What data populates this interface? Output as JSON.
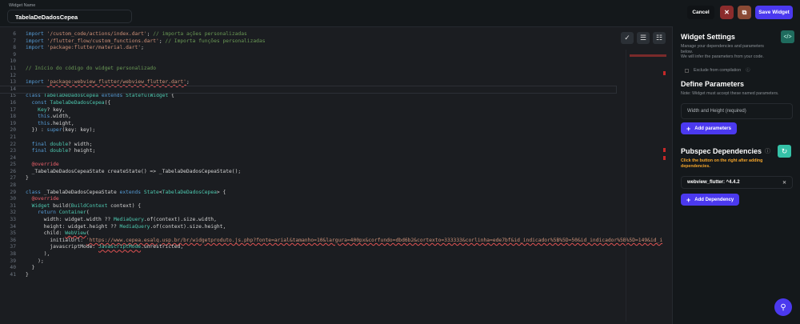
{
  "header": {
    "widget_name_label": "Widget Name",
    "widget_name": "TabelaDeDadosCepea",
    "cancel": "Cancel",
    "save": "Save Widget"
  },
  "editor": {
    "lines": [
      {
        "n": "6",
        "t": [
          [
            "import",
            "kw"
          ],
          " ",
          [
            "'/custom_code/actions/index.dart'",
            "str"
          ],
          "; ",
          [
            "// importa ações personalizadas",
            "cm"
          ]
        ]
      },
      {
        "n": "7",
        "t": [
          [
            "import",
            "kw"
          ],
          " ",
          [
            "'/flutter_flow/custom_functions.dart'",
            "str"
          ],
          "; ",
          [
            "// Importa funções personalizadas",
            "cm"
          ]
        ]
      },
      {
        "n": "8",
        "t": [
          [
            "import",
            "kw"
          ],
          " ",
          [
            "'package:flutter/material.dart'",
            "str"
          ],
          ";"
        ]
      },
      {
        "n": "9",
        "t": []
      },
      {
        "n": "10",
        "t": []
      },
      {
        "n": "11",
        "t": [
          [
            "// Início do código do widget personalizado",
            "cm"
          ]
        ]
      },
      {
        "n": "12",
        "t": []
      },
      {
        "n": "13",
        "t": [
          [
            "import",
            "kw"
          ],
          " ",
          [
            "'package:webview_flutter/webview_flutter.dart'",
            "str u"
          ],
          ";"
        ]
      },
      {
        "n": "14",
        "t": [],
        "cur": true
      },
      {
        "n": "15",
        "t": [
          [
            "class",
            "kw"
          ],
          " ",
          [
            "TabelaDeDadosCepea",
            "ty"
          ],
          " ",
          [
            "extends",
            "kw"
          ],
          " ",
          [
            "StatefulWidget",
            "ty"
          ],
          " {"
        ]
      },
      {
        "n": "16",
        "t": [
          "  ",
          [
            "const",
            "kw"
          ],
          " ",
          [
            "TabelaDeDadosCepea",
            "ty"
          ],
          "({"
        ]
      },
      {
        "n": "17",
        "t": [
          "    ",
          [
            "Key",
            "ty"
          ],
          "? key,"
        ]
      },
      {
        "n": "18",
        "t": [
          "    ",
          [
            "this",
            "kw"
          ],
          ".width,"
        ]
      },
      {
        "n": "19",
        "t": [
          "    ",
          [
            "this",
            "kw"
          ],
          ".height,"
        ]
      },
      {
        "n": "20",
        "t": [
          "  }) : ",
          [
            "super",
            "kw"
          ],
          "(key: key);"
        ]
      },
      {
        "n": "21",
        "t": []
      },
      {
        "n": "22",
        "t": [
          "  ",
          [
            "final",
            "kw"
          ],
          " ",
          [
            "double",
            "ty"
          ],
          "? width;"
        ]
      },
      {
        "n": "23",
        "t": [
          "  ",
          [
            "final",
            "kw"
          ],
          " ",
          [
            "double",
            "ty"
          ],
          "? height;"
        ]
      },
      {
        "n": "24",
        "t": []
      },
      {
        "n": "25",
        "t": [
          "  ",
          [
            "@override",
            "an"
          ]
        ]
      },
      {
        "n": "26",
        "t": [
          "  _TabelaDeDadosCepeaState createState() => _TabelaDeDadosCepeaState();"
        ]
      },
      {
        "n": "27",
        "t": [
          "}"
        ]
      },
      {
        "n": "28",
        "t": []
      },
      {
        "n": "29",
        "t": [
          [
            "class",
            "kw"
          ],
          " _TabelaDeDadosCepeaState ",
          [
            "extends",
            "kw"
          ],
          " ",
          [
            "State",
            "ty"
          ],
          "<",
          [
            "TabelaDeDadosCepea",
            "ty"
          ],
          "> {"
        ]
      },
      {
        "n": "30",
        "t": [
          "  ",
          [
            "@override",
            "an"
          ]
        ]
      },
      {
        "n": "31",
        "t": [
          "  ",
          [
            "Widget",
            "ty"
          ],
          " build(",
          [
            "BuildContext",
            "ty"
          ],
          " context) {"
        ]
      },
      {
        "n": "32",
        "t": [
          "    ",
          [
            "return",
            "kw"
          ],
          " ",
          [
            "Container",
            "ty"
          ],
          "("
        ]
      },
      {
        "n": "33",
        "t": [
          "      width: widget.width ?? ",
          [
            "MediaQuery",
            "ty"
          ],
          ".of(context).size.width,"
        ]
      },
      {
        "n": "34",
        "t": [
          "      height: widget.height ?? ",
          [
            "MediaQuery",
            "ty"
          ],
          ".of(context).size.height,"
        ]
      },
      {
        "n": "35",
        "t": [
          "      child: ",
          [
            "WebView",
            "ty u"
          ],
          "("
        ]
      },
      {
        "n": "36",
        "t": [
          "        initialUrl: ",
          [
            "'https://www.cepea.esalq.usp.br/br/widgetproduto.js.php?fonte=arial&tamanho=10&largura=400px&corfundo=dbd6b2&cortexto=333333&corlinha=ede7bf&id_indicador%5B%5D=50&id_indicador%5B%5D=149&id_i",
            "str u"
          ]
        ]
      },
      {
        "n": "37",
        "t": [
          "        javascriptMode: ",
          [
            "JavascriptMode",
            "ty u"
          ],
          ".unrestricted,"
        ]
      },
      {
        "n": "38",
        "t": [
          "      ),"
        ]
      },
      {
        "n": "39",
        "t": [
          "    );"
        ]
      },
      {
        "n": "40",
        "t": [
          "  }"
        ]
      },
      {
        "n": "41",
        "t": [
          "}"
        ]
      }
    ]
  },
  "panel": {
    "title": "Widget Settings",
    "desc1": "Manage your dependencies and parameters below.",
    "desc2": "We will infer the parameters from your code.",
    "exclude": "Exclude from compilation",
    "params_title": "Define Parameters",
    "params_note": "Note: Widget must accept these named parameters.",
    "params_value": "Width and Height (required)",
    "add_params": "Add parameters",
    "deps_title": "Pubspec Dependencies",
    "deps_note": "Click the button on the right after adding dependencies.",
    "dependency": "webview_flutter: ^4.4.2",
    "add_dep": "Add Dependency"
  },
  "colors": {
    "accent": "#4b39ef",
    "teal": "#249689",
    "warning": "#f4a52a",
    "danger": "#8b2c2c"
  }
}
